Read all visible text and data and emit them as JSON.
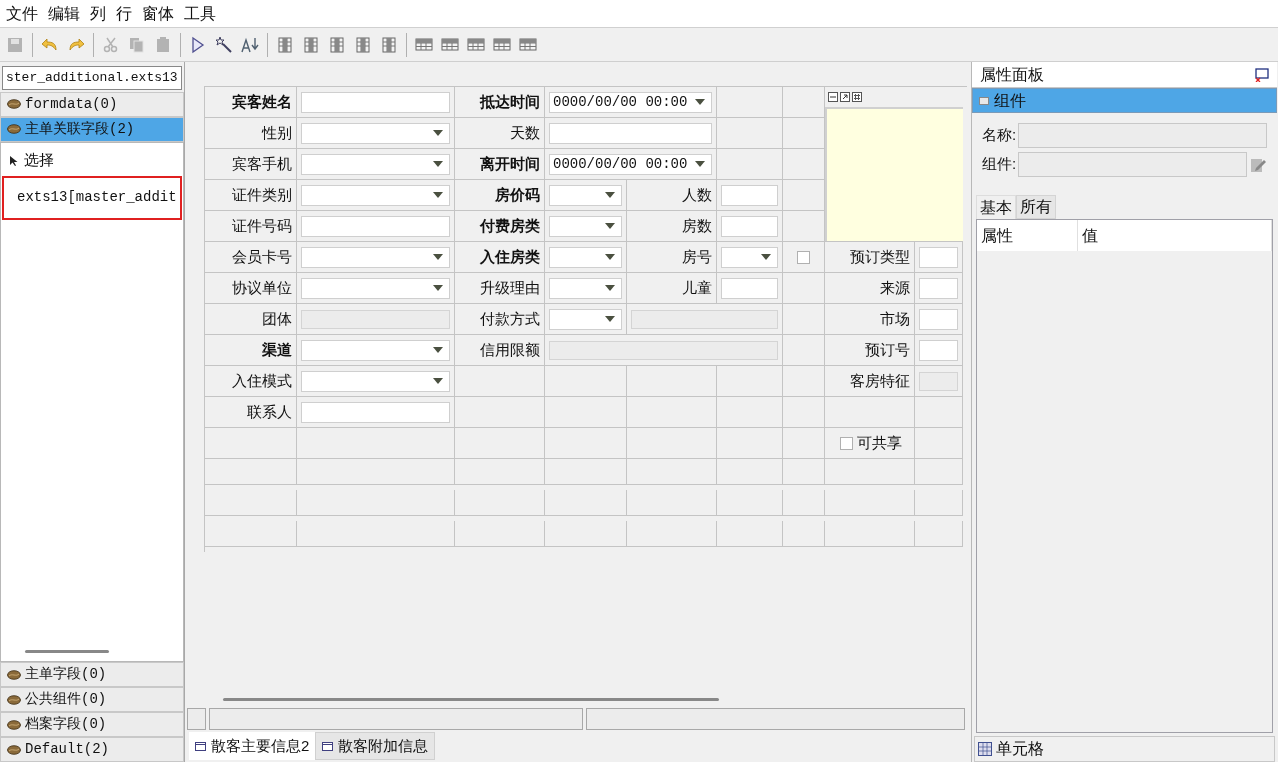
{
  "menu": [
    "文件",
    "编辑",
    "列",
    "行",
    "窗体",
    "工具"
  ],
  "toolbar": [
    {
      "kind": "save",
      "disabled": true
    },
    {
      "kind": "undo",
      "disabled": false
    },
    {
      "kind": "redo",
      "disabled": false
    },
    {
      "kind": "cut",
      "disabled": true
    },
    {
      "kind": "copy",
      "disabled": true
    },
    {
      "kind": "paste",
      "disabled": true
    },
    {
      "kind": "run",
      "disabled": false
    },
    {
      "kind": "wand",
      "disabled": false
    },
    {
      "kind": "sort",
      "disabled": false
    },
    {
      "kind": "column",
      "disabled": false
    },
    {
      "kind": "column",
      "disabled": false
    },
    {
      "kind": "column",
      "disabled": false
    },
    {
      "kind": "column",
      "disabled": false
    },
    {
      "kind": "column",
      "disabled": false
    },
    {
      "kind": "row",
      "disabled": false
    },
    {
      "kind": "row",
      "disabled": false
    },
    {
      "kind": "row",
      "disabled": false
    },
    {
      "kind": "row",
      "disabled": false
    },
    {
      "kind": "row",
      "disabled": false
    }
  ],
  "left_panel": {
    "search_value": "ster_additional.exts13",
    "groups_top": [
      {
        "label": "formdata(0)",
        "selected": false
      },
      {
        "label": "主单关联字段(2)",
        "selected": true
      }
    ],
    "items": [
      {
        "kind": "pointer",
        "label": "选择",
        "highlighted": false
      },
      {
        "kind": "field",
        "label": "exts13[master_addit",
        "highlighted": true
      }
    ],
    "groups_bottom": [
      {
        "label": "主单字段(0)",
        "selected": false
      },
      {
        "label": "公共组件(0)",
        "selected": false
      },
      {
        "label": "档案字段(0)",
        "selected": false
      },
      {
        "label": "Default(2)",
        "selected": false
      }
    ]
  },
  "form": {
    "rows": [
      [
        {
          "kind": "label",
          "text": "宾客姓名",
          "bold": true
        },
        {
          "kind": "text"
        },
        {
          "kind": "label",
          "text": "抵达时间",
          "bold": true
        },
        {
          "kind": "datetime",
          "value": "0000/00/00 00:00"
        }
      ],
      [
        {
          "kind": "label",
          "text": "性别",
          "bold": false
        },
        {
          "kind": "select"
        },
        {
          "kind": "label",
          "text": "天数",
          "bold": false
        },
        {
          "kind": "text_wide"
        }
      ],
      [
        {
          "kind": "label",
          "text": "宾客手机",
          "bold": false
        },
        {
          "kind": "select"
        },
        {
          "kind": "label",
          "text": "离开时间",
          "bold": true
        },
        {
          "kind": "datetime",
          "value": "0000/00/00 00:00"
        }
      ],
      [
        {
          "kind": "label",
          "text": "证件类别",
          "bold": false
        },
        {
          "kind": "select"
        },
        {
          "kind": "label",
          "text": "房价码",
          "bold": true
        },
        {
          "kind": "select"
        },
        {
          "kind": "label",
          "text": "人数",
          "bold": false
        },
        {
          "kind": "text"
        }
      ],
      [
        {
          "kind": "label",
          "text": "证件号码",
          "bold": false
        },
        {
          "kind": "text"
        },
        {
          "kind": "label",
          "text": "付费房类",
          "bold": true
        },
        {
          "kind": "select"
        },
        {
          "kind": "label",
          "text": "房数",
          "bold": false
        },
        {
          "kind": "text"
        }
      ],
      [
        {
          "kind": "label",
          "text": "会员卡号",
          "bold": false
        },
        {
          "kind": "select"
        },
        {
          "kind": "label",
          "text": "入住房类",
          "bold": true
        },
        {
          "kind": "select"
        },
        {
          "kind": "label",
          "text": "房号",
          "bold": false
        },
        {
          "kind": "select"
        },
        {
          "kind": "checkbox",
          "checked": false
        },
        {
          "kind": "label",
          "text": "预订类型",
          "bold": false
        },
        {
          "kind": "text"
        }
      ],
      [
        {
          "kind": "label",
          "text": "协议单位",
          "bold": false
        },
        {
          "kind": "select"
        },
        {
          "kind": "label",
          "text": "升级理由",
          "bold": false
        },
        {
          "kind": "select"
        },
        {
          "kind": "label",
          "text": "儿童",
          "bold": false
        },
        {
          "kind": "text"
        },
        {
          "kind": "blank"
        },
        {
          "kind": "label",
          "text": "来源",
          "bold": false
        },
        {
          "kind": "text"
        }
      ],
      [
        {
          "kind": "label",
          "text": "团体",
          "bold": false
        },
        {
          "kind": "readonly"
        },
        {
          "kind": "label",
          "text": "付款方式",
          "bold": false
        },
        {
          "kind": "select"
        },
        {
          "kind": "readonly_wide"
        },
        {
          "kind": "blank"
        },
        {
          "kind": "label",
          "text": "市场",
          "bold": false
        },
        {
          "kind": "text"
        }
      ],
      [
        {
          "kind": "label",
          "text": "渠道",
          "bold": true
        },
        {
          "kind": "select"
        },
        {
          "kind": "label",
          "text": "信用限额",
          "bold": false
        },
        {
          "kind": "readonly_full"
        },
        {
          "kind": "blank"
        },
        {
          "kind": "label",
          "text": "预订号",
          "bold": false
        },
        {
          "kind": "text"
        }
      ],
      [
        {
          "kind": "label",
          "text": "入住模式",
          "bold": false
        },
        {
          "kind": "select"
        },
        {
          "kind": "blank"
        },
        {
          "kind": "blank"
        },
        {
          "kind": "blank"
        },
        {
          "kind": "blank"
        },
        {
          "kind": "blank"
        },
        {
          "kind": "label",
          "text": "客房特征",
          "bold": false
        },
        {
          "kind": "readonly"
        }
      ],
      [
        {
          "kind": "label",
          "text": "联系人",
          "bold": false
        },
        {
          "kind": "text"
        }
      ],
      [
        {
          "kind": "blank"
        },
        {
          "kind": "blank"
        },
        {
          "kind": "blank"
        },
        {
          "kind": "blank"
        },
        {
          "kind": "blank"
        },
        {
          "kind": "blank"
        },
        {
          "kind": "blank"
        },
        {
          "kind": "checkbox_label",
          "label": "可共享",
          "checked": false
        }
      ]
    ]
  },
  "sheet_tabs": [
    {
      "label": "散客主要信息2",
      "selected": true
    },
    {
      "label": "散客附加信息",
      "selected": false
    }
  ],
  "properties_panel": {
    "title": "属性面板",
    "header": "组件",
    "fields": [
      {
        "label": "名称:",
        "kind": "plain"
      },
      {
        "label": "组件:",
        "kind": "with_button"
      }
    ],
    "tabs": [
      {
        "label": "基本",
        "selected": true
      },
      {
        "label": "所有",
        "selected": false
      }
    ],
    "columns": [
      "属性",
      "值"
    ],
    "footer": "单元格"
  }
}
